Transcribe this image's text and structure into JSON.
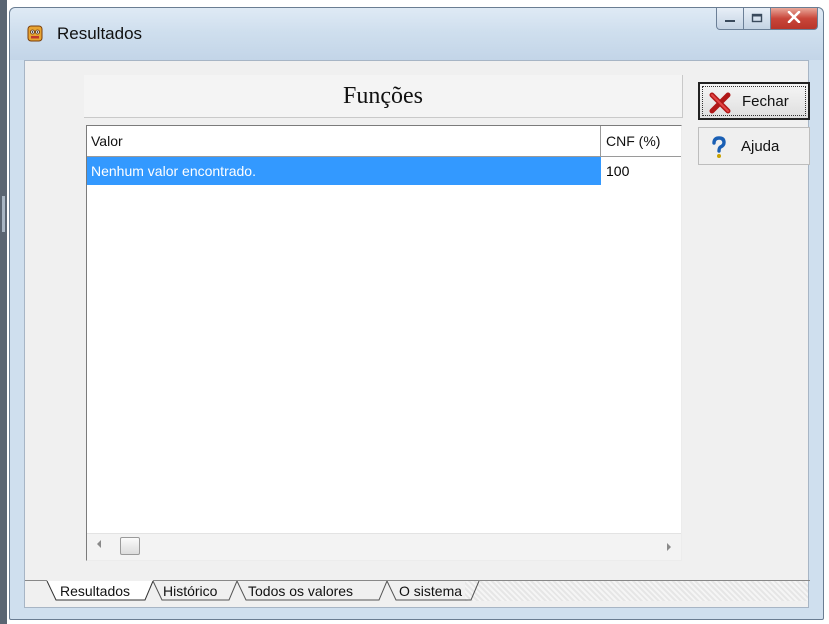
{
  "window": {
    "title": "Resultados"
  },
  "header": {
    "title": "Funções"
  },
  "grid": {
    "columns": [
      "Valor",
      "CNF (%)"
    ],
    "rows": [
      {
        "valor": "Nenhum valor encontrado.",
        "cnf": "100"
      }
    ]
  },
  "buttons": {
    "close_label": "Fechar",
    "help_label": "Ajuda"
  },
  "tabs": [
    "Resultados",
    "Histórico",
    "Todos os valores",
    "O sistema"
  ],
  "icons": {
    "app": "app-face-icon",
    "close": "red-x-icon",
    "help": "blue-question-icon"
  },
  "colors": {
    "selection": "#3399ff",
    "window_frame": "#cfdfee",
    "close_button": "#c9463a"
  }
}
